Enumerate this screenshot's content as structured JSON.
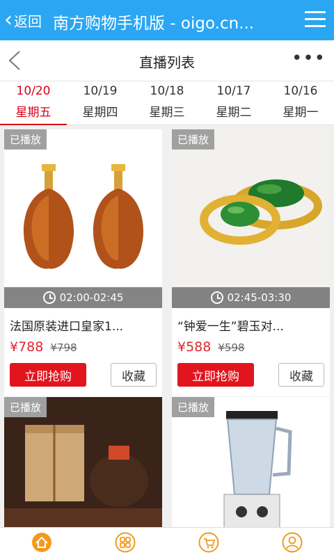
{
  "topbar": {
    "back_label": "返回",
    "title": "南方购物手机版 - oigo.cn..."
  },
  "header": {
    "title": "直播列表"
  },
  "tabs": [
    {
      "date": "10/20",
      "weekday": "星期五",
      "active": true
    },
    {
      "date": "10/19",
      "weekday": "星期四",
      "active": false
    },
    {
      "date": "10/18",
      "weekday": "星期三",
      "active": false
    },
    {
      "date": "10/17",
      "weekday": "星期二",
      "active": false
    },
    {
      "date": "10/16",
      "weekday": "星期一",
      "active": false
    }
  ],
  "products": [
    {
      "badge": "已播放",
      "time": "02:00-02:45",
      "name": "法国原装进口皇家1...",
      "price": "¥788",
      "old_price": "¥798",
      "buy_label": "立即抢购",
      "fav_label": "收藏",
      "image": "cognac-bottles"
    },
    {
      "badge": "已播放",
      "time": "02:45-03:30",
      "name": "“钟爱一生”碧玉对...",
      "price": "¥588",
      "old_price": "¥598",
      "buy_label": "立即抢购",
      "fav_label": "收藏",
      "image": "jade-rings"
    },
    {
      "badge": "已播放",
      "image": "liquor-gift-box"
    },
    {
      "badge": "已播放",
      "image": "blender"
    }
  ],
  "bottom_nav": [
    {
      "icon": "home-icon"
    },
    {
      "icon": "category-icon"
    },
    {
      "icon": "cart-icon"
    },
    {
      "icon": "user-icon"
    }
  ],
  "colors": {
    "topbar": "#2aa6f3",
    "accent_red": "#e2141e",
    "nav_orange": "#f39a1e"
  }
}
